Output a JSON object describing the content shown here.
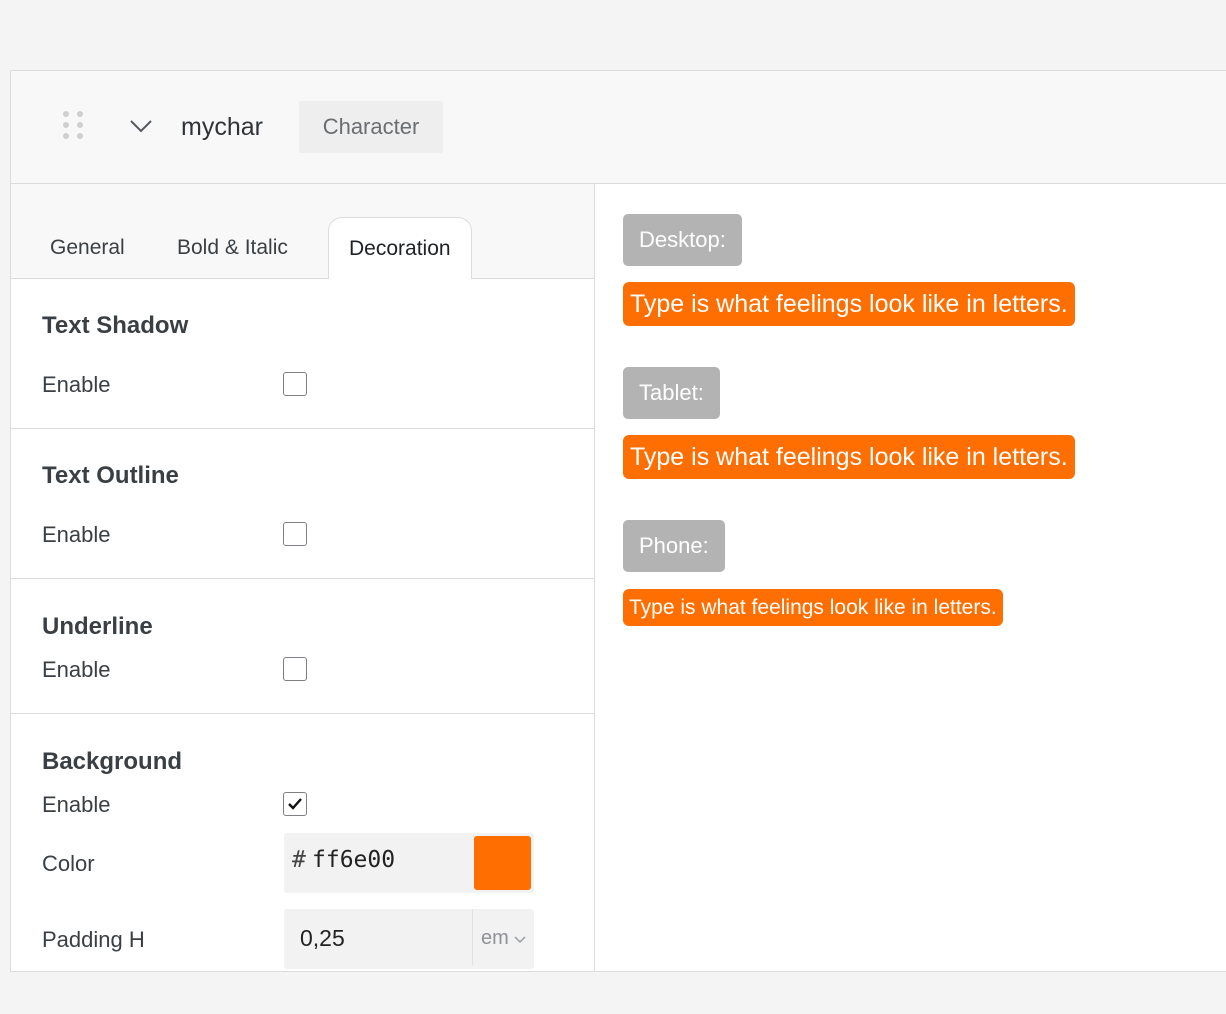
{
  "header": {
    "title": "mychar",
    "type_badge": "Character"
  },
  "tabs": [
    {
      "label": "General",
      "active": false
    },
    {
      "label": "Bold & Italic",
      "active": false
    },
    {
      "label": "Decoration",
      "active": true
    }
  ],
  "sections": {
    "text_shadow": {
      "title": "Text Shadow",
      "enable_label": "Enable",
      "enabled": false
    },
    "text_outline": {
      "title": "Text Outline",
      "enable_label": "Enable",
      "enabled": false
    },
    "underline": {
      "title": "Underline",
      "enable_label": "Enable",
      "enabled": false
    },
    "background": {
      "title": "Background",
      "enable_label": "Enable",
      "enabled": true,
      "color_label": "Color",
      "color_hash": "#",
      "color_value": "ff6e00",
      "color_swatch": "#ff6e00",
      "padding_h_label": "Padding H",
      "padding_h_value": "0,25",
      "padding_h_unit": "em"
    }
  },
  "preview": {
    "desktop_label": "Desktop:",
    "tablet_label": "Tablet:",
    "phone_label": "Phone:",
    "sample_text": "Type is what feelings look like in letters.",
    "accent_color": "#ff6e00"
  },
  "icons": {
    "drag": "drag-handle-icon",
    "collapse": "chevron-down-icon",
    "check": "checkmark-icon",
    "unit_dropdown": "chevron-down-icon"
  }
}
